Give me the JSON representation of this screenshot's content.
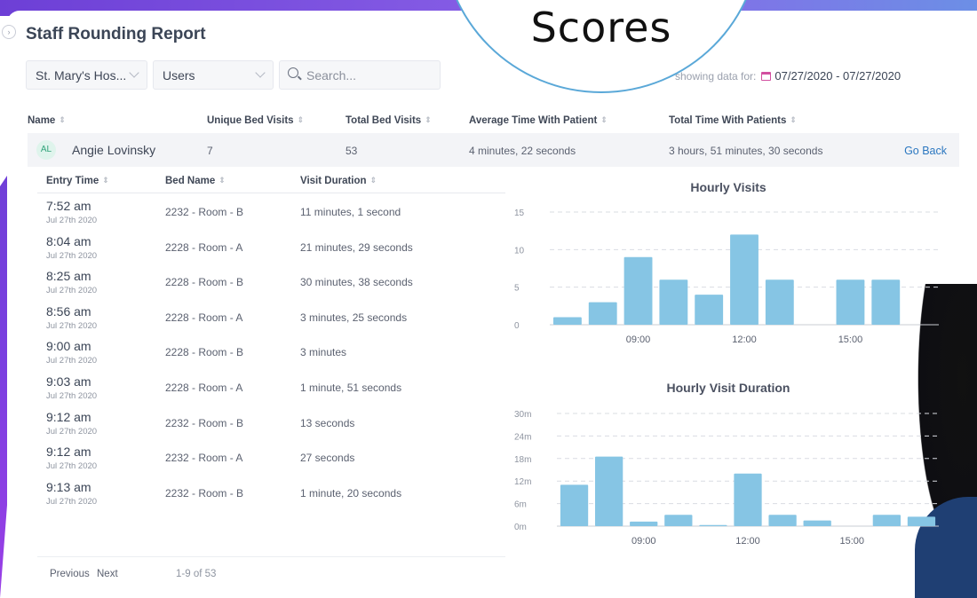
{
  "overlay": {
    "circle_text": "Scores"
  },
  "page": {
    "title": "Staff Rounding Report"
  },
  "filters": {
    "hospital": "St. Mary's Hos...",
    "users": "Users",
    "search_placeholder": "Search...",
    "showing_label": "showing data for:",
    "date_range": "07/27/2020 - 07/27/2020"
  },
  "table_headers": {
    "name": "Name",
    "unique_bed_visits": "Unique Bed Visits",
    "total_bed_visits": "Total Bed Visits",
    "avg_time": "Average Time With Patient",
    "total_time": "Total Time With Patients"
  },
  "user": {
    "initials": "AL",
    "name": "Angie Lovinsky",
    "unique_bed_visits": "7",
    "total_bed_visits": "53",
    "avg_time": "4 minutes, 22 seconds",
    "total_time": "3 hours, 51 minutes, 30 seconds",
    "go_back": "Go Back"
  },
  "visits_headers": {
    "entry_time": "Entry Time",
    "bed_name": "Bed Name",
    "visit_duration": "Visit Duration"
  },
  "visits": [
    {
      "time": "7:52 am",
      "date": "Jul 27th 2020",
      "bed": "2232 - Room - B",
      "duration": "11 minutes, 1 second"
    },
    {
      "time": "8:04 am",
      "date": "Jul 27th 2020",
      "bed": "2228 - Room - A",
      "duration": "21 minutes, 29 seconds"
    },
    {
      "time": "8:25 am",
      "date": "Jul 27th 2020",
      "bed": "2228 - Room - B",
      "duration": "30 minutes, 38 seconds"
    },
    {
      "time": "8:56 am",
      "date": "Jul 27th 2020",
      "bed": "2228 - Room - A",
      "duration": "3 minutes, 25 seconds"
    },
    {
      "time": "9:00 am",
      "date": "Jul 27th 2020",
      "bed": "2228 - Room - B",
      "duration": "3 minutes"
    },
    {
      "time": "9:03 am",
      "date": "Jul 27th 2020",
      "bed": "2228 - Room - A",
      "duration": "1 minute, 51 seconds"
    },
    {
      "time": "9:12 am",
      "date": "Jul 27th 2020",
      "bed": "2232 - Room - B",
      "duration": "13 seconds"
    },
    {
      "time": "9:12 am",
      "date": "Jul 27th 2020",
      "bed": "2232 - Room - A",
      "duration": "27 seconds"
    },
    {
      "time": "9:13 am",
      "date": "Jul 27th 2020",
      "bed": "2232 - Room - B",
      "duration": "1 minute, 20 seconds"
    }
  ],
  "pagination": {
    "previous": "Previous",
    "next": "Next",
    "summary": "1-9 of 53"
  },
  "chart_data": [
    {
      "type": "bar",
      "title": "Hourly Visits",
      "bar_color": "#86c5e4",
      "categories": [
        7,
        8,
        9,
        10,
        11,
        12,
        13,
        14,
        15,
        16,
        17
      ],
      "values": [
        1,
        3,
        9,
        6,
        4,
        12,
        6,
        0,
        6,
        6,
        0
      ],
      "ylim": [
        0,
        15
      ],
      "yticks": [
        "0",
        "5",
        "10",
        "15"
      ],
      "xticks": [
        "09:00",
        "12:00",
        "15:00"
      ],
      "grid": true
    },
    {
      "type": "bar",
      "title": "Hourly Visit Duration",
      "bar_color": "#86c5e4",
      "categories": [
        7,
        8,
        9,
        10,
        11,
        12,
        13,
        14,
        15,
        16,
        17
      ],
      "values": [
        11,
        18.5,
        1.2,
        3,
        0.3,
        14,
        3,
        1.5,
        0,
        3,
        2.5
      ],
      "ylim": [
        0,
        30
      ],
      "yticks": [
        "0m",
        "6m",
        "12m",
        "18m",
        "24m",
        "30m"
      ],
      "xticks": [
        "09:00",
        "12:00",
        "15:00"
      ],
      "grid": true
    }
  ]
}
